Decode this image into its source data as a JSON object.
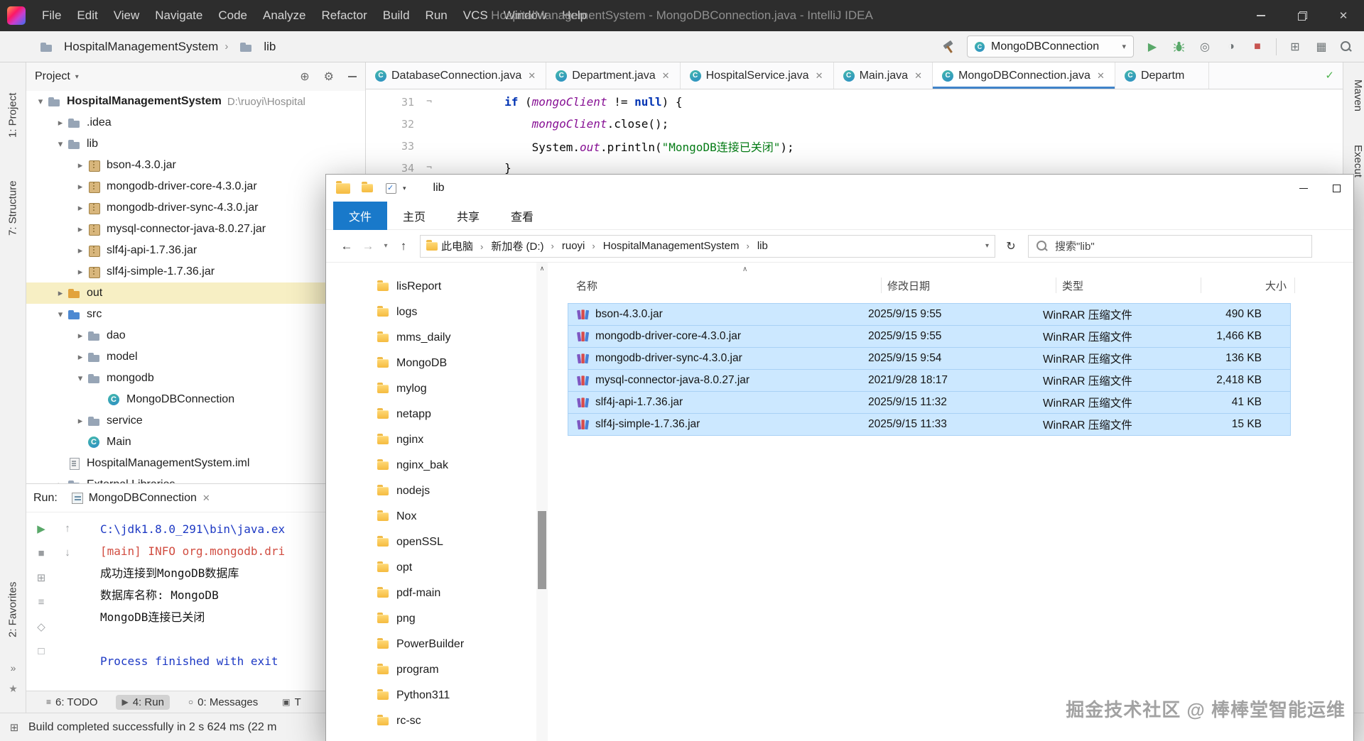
{
  "ide": {
    "titlebar": {
      "menus": [
        "File",
        "Edit",
        "View",
        "Navigate",
        "Code",
        "Analyze",
        "Refactor",
        "Build",
        "Run",
        "VCS",
        "Window",
        "Help"
      ],
      "title": "HospitalManagementSystem - MongoDBConnection.java - IntelliJ IDEA"
    },
    "toolbar": {
      "breadcrumb": [
        {
          "label": "HospitalManagementSystem"
        },
        {
          "label": "lib"
        }
      ],
      "run_config": "MongoDBConnection"
    },
    "stripes": {
      "project": "1: Project",
      "structure": "7: Structure",
      "favorites": "2: Favorites",
      "maven": "Maven",
      "executions": "Execut"
    },
    "project_panel": {
      "title": "Project",
      "tree": [
        {
          "label": "HospitalManagementSystem",
          "extra": "D:\\ruoyi\\Hospital",
          "cls": "lvl0 root",
          "arrow": "down",
          "icon": "folder"
        },
        {
          "label": ".idea",
          "cls": "lvl1",
          "arrow": "right",
          "icon": "folder"
        },
        {
          "label": "lib",
          "cls": "lvl1",
          "arrow": "down",
          "icon": "folder"
        },
        {
          "label": "bson-4.3.0.jar",
          "cls": "lvl2",
          "arrow": "right",
          "icon": "jar"
        },
        {
          "label": "mongodb-driver-core-4.3.0.jar",
          "cls": "lvl2",
          "arrow": "right",
          "icon": "jar"
        },
        {
          "label": "mongodb-driver-sync-4.3.0.jar",
          "cls": "lvl2",
          "arrow": "right",
          "icon": "jar"
        },
        {
          "label": "mysql-connector-java-8.0.27.jar",
          "cls": "lvl2",
          "arrow": "right",
          "icon": "jar"
        },
        {
          "label": "slf4j-api-1.7.36.jar",
          "cls": "lvl2",
          "arrow": "right",
          "icon": "jar"
        },
        {
          "label": "slf4j-simple-1.7.36.jar",
          "cls": "lvl2",
          "arrow": "right",
          "icon": "jar"
        },
        {
          "label": "out",
          "cls": "lvl1 hl",
          "arrow": "right",
          "icon": "folder-out"
        },
        {
          "label": "src",
          "cls": "lvl1",
          "arrow": "down",
          "icon": "folder-src"
        },
        {
          "label": "dao",
          "cls": "lvl2",
          "arrow": "right",
          "icon": "folder"
        },
        {
          "label": "model",
          "cls": "lvl2",
          "arrow": "right",
          "icon": "folder"
        },
        {
          "label": "mongodb",
          "cls": "lvl2",
          "arrow": "down",
          "icon": "folder"
        },
        {
          "label": "MongoDBConnection",
          "cls": "lvl3",
          "arrow": "none",
          "icon": "class"
        },
        {
          "label": "service",
          "cls": "lvl2",
          "arrow": "right",
          "icon": "folder"
        },
        {
          "label": "Main",
          "cls": "lvl2",
          "arrow": "none",
          "icon": "class"
        },
        {
          "label": "HospitalManagementSystem.iml",
          "cls": "lvl1",
          "arrow": "none",
          "icon": "iml"
        },
        {
          "label": "External Libraries",
          "cls": "lvl1",
          "arrow": "right",
          "icon": "folder"
        }
      ]
    },
    "tabs": [
      {
        "label": "DatabaseConnection.java",
        "cls": "plain",
        "x": "x"
      },
      {
        "label": "Department.java",
        "cls": "plain",
        "x": "x"
      },
      {
        "label": "HospitalService.java",
        "cls": "plain",
        "x": "x"
      },
      {
        "label": "Main.java",
        "cls": "plain",
        "x": "x"
      },
      {
        "label": "MongoDBConnection.java",
        "cls": "active",
        "x": "x"
      },
      {
        "label": "Departm",
        "cls": "clip"
      }
    ],
    "editor": {
      "lines": [
        {
          "num": "31",
          "fold": "fold",
          "seg": [
            {
              "t": "        ",
              "c": "pl"
            },
            {
              "t": "if ",
              "c": "kw"
            },
            {
              "t": "(",
              "c": "pl"
            },
            {
              "t": "mongoClient",
              "c": "fld"
            },
            {
              "t": " != ",
              "c": "pl"
            },
            {
              "t": "null",
              "c": "kw"
            },
            {
              "t": ") {",
              "c": "pl"
            }
          ]
        },
        {
          "num": "32",
          "seg": [
            {
              "t": "            ",
              "c": "pl"
            },
            {
              "t": "mongoClient",
              "c": "fld"
            },
            {
              "t": ".close();",
              "c": "pl"
            }
          ]
        },
        {
          "num": "33",
          "seg": [
            {
              "t": "            ",
              "c": "pl"
            },
            {
              "t": "System.",
              "c": "pl"
            },
            {
              "t": "out",
              "c": "fld"
            },
            {
              "t": ".println(",
              "c": "pl"
            },
            {
              "t": "\"MongoDB连接已关闭\"",
              "c": "str"
            },
            {
              "t": ");",
              "c": "pl"
            }
          ]
        },
        {
          "num": "34",
          "fold": "fold",
          "seg": [
            {
              "t": "        }",
              "c": "pl"
            }
          ]
        }
      ]
    },
    "run_panel": {
      "label": "Run:",
      "tab": "MongoDBConnection",
      "gutter1": [
        {
          "g": "▶",
          "cls": "green"
        },
        {
          "g": "■",
          "cls": "gray"
        },
        {
          "g": "⊞",
          "cls": "gray"
        },
        {
          "g": "≡",
          "cls": "gray"
        },
        {
          "g": "◇",
          "cls": "gray"
        },
        {
          "g": "□",
          "cls": "gray"
        }
      ],
      "gutter2": [
        {
          "g": "↑",
          "cls": "gray"
        },
        {
          "g": "↓",
          "cls": "gray"
        }
      ],
      "console": [
        {
          "t": "C:\\jdk1.8.0_291\\bin\\java.ex",
          "c": "blue"
        },
        {
          "t": "[main] INFO org.mongodb.dri",
          "c": "red"
        },
        {
          "t": "成功连接到MongoDB数据库",
          "c": "black"
        },
        {
          "t": "数据库名称: MongoDB",
          "c": "black"
        },
        {
          "t": "MongoDB连接已关闭",
          "c": "black"
        },
        {
          "t": "",
          "c": "black"
        },
        {
          "t": "Process finished with exit",
          "c": "blue"
        }
      ]
    },
    "statusbar": {
      "tools": [
        {
          "icon": "≡",
          "label": "6: TODO",
          "cls": "plain"
        },
        {
          "icon": "▶",
          "label": "4: Run",
          "cls": "active"
        },
        {
          "icon": "○",
          "label": "0: Messages",
          "cls": "plain"
        },
        {
          "icon": "▣",
          "label": "T",
          "cls": "plain"
        }
      ],
      "message": "Build completed successfully in 2 s 624 ms (22 m"
    }
  },
  "explorer": {
    "title": "lib",
    "ribbon": [
      {
        "label": "文件",
        "cls": "file"
      },
      {
        "label": "主页",
        "cls": "plain"
      },
      {
        "label": "共享",
        "cls": "plain"
      },
      {
        "label": "查看",
        "cls": "plain"
      }
    ],
    "address": [
      {
        "label": "此电脑"
      },
      {
        "label": "新加卷 (D:)"
      },
      {
        "label": "ruoyi"
      },
      {
        "label": "HospitalManagementSystem"
      },
      {
        "label": "lib"
      }
    ],
    "search": "搜索\"lib\"",
    "sidebar": [
      "lisReport",
      "logs",
      "mms_daily",
      "MongoDB",
      "mylog",
      "netapp",
      "nginx",
      "nginx_bak",
      "nodejs",
      "Nox",
      "openSSL",
      "opt",
      "pdf-main",
      "png",
      "PowerBuilder",
      "program",
      "Python311",
      "rc-sc"
    ],
    "columns": {
      "name": "名称",
      "date": "修改日期",
      "type": "类型",
      "size": "大小"
    },
    "files": [
      {
        "name": "bson-4.3.0.jar",
        "date": "2025/9/15 9:55",
        "type": "WinRAR 压缩文件",
        "size": "490 KB"
      },
      {
        "name": "mongodb-driver-core-4.3.0.jar",
        "date": "2025/9/15 9:55",
        "type": "WinRAR 压缩文件",
        "size": "1,466 KB"
      },
      {
        "name": "mongodb-driver-sync-4.3.0.jar",
        "date": "2025/9/15 9:54",
        "type": "WinRAR 压缩文件",
        "size": "136 KB"
      },
      {
        "name": "mysql-connector-java-8.0.27.jar",
        "date": "2021/9/28 18:17",
        "type": "WinRAR 压缩文件",
        "size": "2,418 KB"
      },
      {
        "name": "slf4j-api-1.7.36.jar",
        "date": "2025/9/15 11:32",
        "type": "WinRAR 压缩文件",
        "size": "41 KB"
      },
      {
        "name": "slf4j-simple-1.7.36.jar",
        "date": "2025/9/15 11:33",
        "type": "WinRAR 压缩文件",
        "size": "15 KB"
      }
    ]
  },
  "watermark": "掘金技术社区 @ 棒棒堂智能运维"
}
